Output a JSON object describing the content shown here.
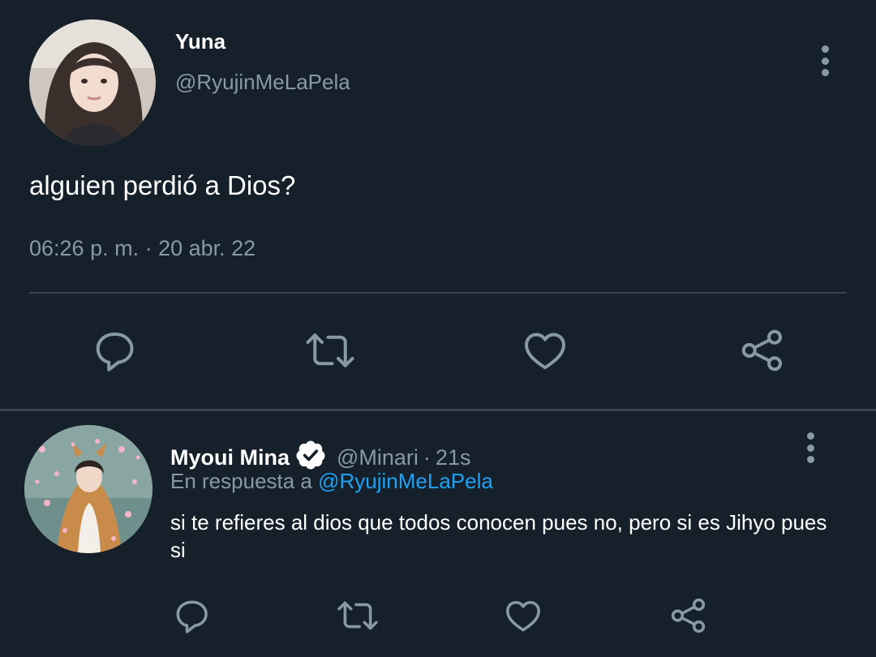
{
  "main_tweet": {
    "author_name": "Yuna",
    "author_handle": "@RyujinMeLaPela",
    "text": "alguien perdió a Dios?",
    "meta": "06:26 p. m. · 20 abr. 22"
  },
  "reply": {
    "author_name": "Myoui Mina",
    "author_handle": "@Minari",
    "separator": "·",
    "time": "21s",
    "in_reply_prefix": "En respuesta a",
    "in_reply_handle": "@RyujinMeLaPela",
    "text": "si te refieres al dios que todos conocen pues no, pero si es Jihyo pues si",
    "verified": true
  },
  "icons": {
    "actions": [
      "reply-icon",
      "retweet-icon",
      "like-icon",
      "share-icon"
    ],
    "more": "more-vertical-icon",
    "badge": "verified-badge-icon"
  },
  "colors": {
    "background": "#15202b",
    "divider": "#38444d",
    "secondary_text": "#8899a6",
    "link": "#1da1f2",
    "primary_text": "#ffffff"
  }
}
